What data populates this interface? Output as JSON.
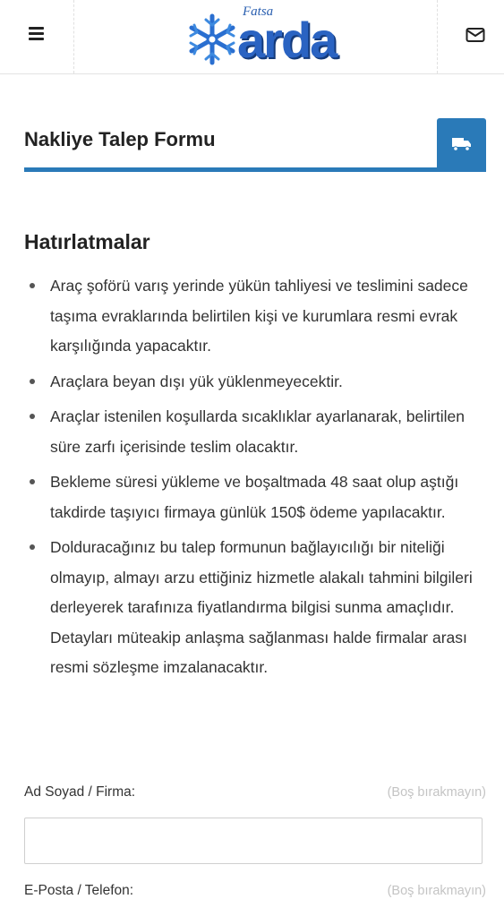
{
  "header": {
    "logo": {
      "small": "Fatsa",
      "word": "arda"
    },
    "menu_icon": "menu-icon",
    "mail_icon": "mail-icon"
  },
  "form": {
    "title": "Nakliye Talep Formu",
    "header_icon": "truck-icon",
    "accent_color": "#2a7ab8"
  },
  "reminders": {
    "title": "Hatırlatmalar",
    "items": [
      "Araç şoförü varış yerinde yükün tahliyesi ve teslimini sadece taşıma evraklarında belirtilen kişi ve kurumlara resmi evrak karşılığında yapacaktır.",
      "Araçlara beyan dışı yük yüklenmeyecektir.",
      "Araçlar istenilen koşullarda sıcaklıklar ayarlanarak, belirtilen süre zarfı içerisinde teslim olacaktır.",
      "Bekleme süresi yükleme ve boşaltmada 48 saat olup aştığı takdirde taşıyıcı firmaya günlük 150$ ödeme yapılacaktır.",
      "Dolduracağınız bu talep formunun bağlayıcılığı bir niteliği olmayıp, almayı arzu ettiğiniz hizmetle alakalı tahmini bilgileri derleyerek tarafınıza fiyatlandırma bilgisi sunma amaçlıdır. Detayları müteakip anlaşma sağlanması halde firmalar arası resmi sözleşme imzalanacaktır."
    ]
  },
  "fields": [
    {
      "label": "Ad Soyad / Firma:",
      "hint": "(Boş bırakmayın)",
      "value": ""
    },
    {
      "label": "E-Posta / Telefon:",
      "hint": "(Boş bırakmayın)",
      "value": ""
    }
  ]
}
